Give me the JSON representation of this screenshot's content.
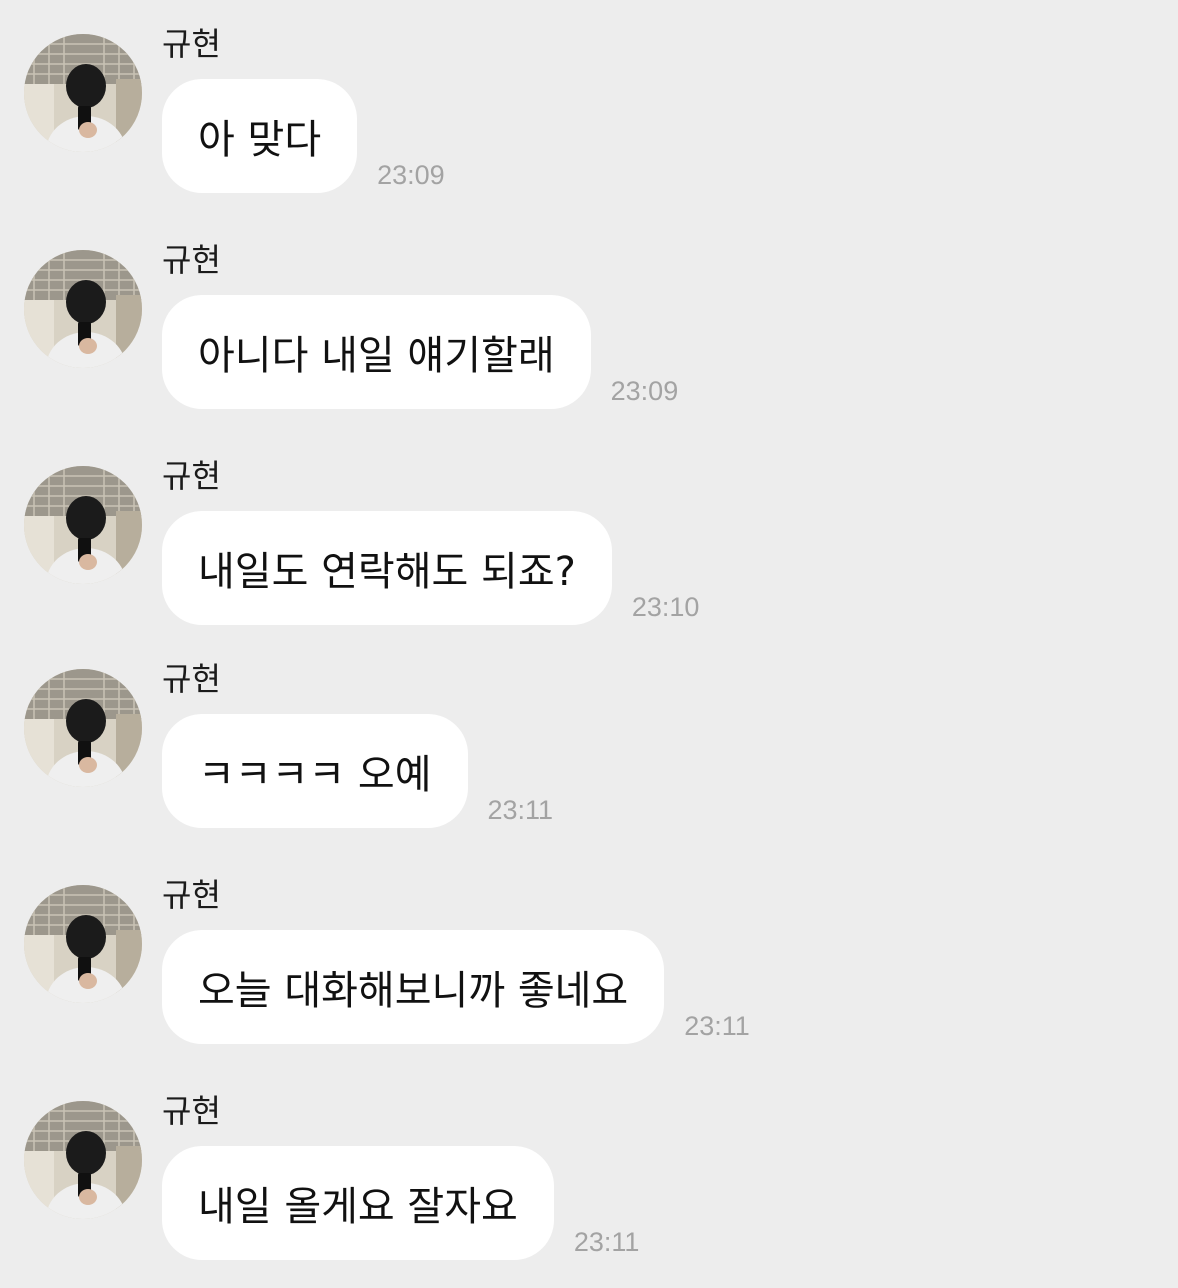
{
  "chat": {
    "messages": [
      {
        "sender": "규현",
        "text": "아 맞다",
        "time": "23:09"
      },
      {
        "sender": "규현",
        "text": "아니다 내일 얘기할래",
        "time": "23:09"
      },
      {
        "sender": "규현",
        "text": "내일도 연락해도 되죠?",
        "time": "23:10"
      },
      {
        "sender": "규현",
        "text": "ㅋㅋㅋㅋ 오예",
        "time": "23:11"
      },
      {
        "sender": "규현",
        "text": "오늘 대화해보니까 좋네요",
        "time": "23:11"
      },
      {
        "sender": "규현",
        "text": "내일 올게요 잘자요",
        "time": "23:11"
      }
    ]
  },
  "colors": {
    "background": "#ededed",
    "bubble": "#ffffff",
    "timestamp": "#a3a3a3"
  },
  "icons": {
    "avatar": "profile-photo"
  }
}
